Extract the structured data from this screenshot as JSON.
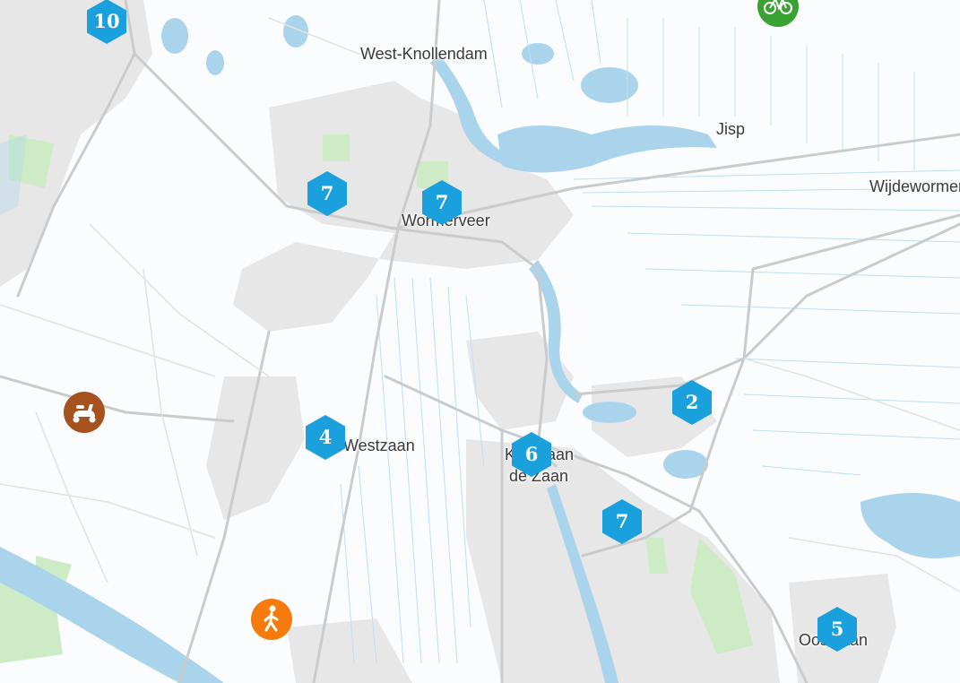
{
  "map": {
    "colors": {
      "water": "#a9d4ec",
      "land": "#fbfcfd",
      "road": "#c9cbcd",
      "urban": "#e7e7e8",
      "green": "#cdebc5",
      "cluster": "#1aa0dc"
    },
    "places": [
      {
        "key": "west_knollendam",
        "label": "West-Knollendam"
      },
      {
        "key": "jisp",
        "label": "Jisp"
      },
      {
        "key": "wijdewormer",
        "label": "Wijdewormer"
      },
      {
        "key": "wormerveer",
        "label": "Wormerveer"
      },
      {
        "key": "westzaan",
        "label": "Westzaan"
      },
      {
        "key": "koog_1",
        "label": "Koog aan"
      },
      {
        "key": "koog_2",
        "label": "de Zaan"
      },
      {
        "key": "oostzaan",
        "label": "Oostzaan"
      }
    ],
    "clusters": [
      {
        "key": "c1",
        "count": "10"
      },
      {
        "key": "c2",
        "count": "7"
      },
      {
        "key": "c3",
        "count": "7"
      },
      {
        "key": "c4",
        "count": "2"
      },
      {
        "key": "c5",
        "count": "4"
      },
      {
        "key": "c6",
        "count": "6"
      },
      {
        "key": "c7",
        "count": "7"
      },
      {
        "key": "c8",
        "count": "5"
      }
    ],
    "pois": [
      {
        "key": "bicycle",
        "icon": "bicycle-icon",
        "color": "#3aa133"
      },
      {
        "key": "scooter",
        "icon": "scooter-icon",
        "color": "#a6521c"
      },
      {
        "key": "walking",
        "icon": "walking-person-icon",
        "color": "#f47b0c"
      }
    ]
  }
}
